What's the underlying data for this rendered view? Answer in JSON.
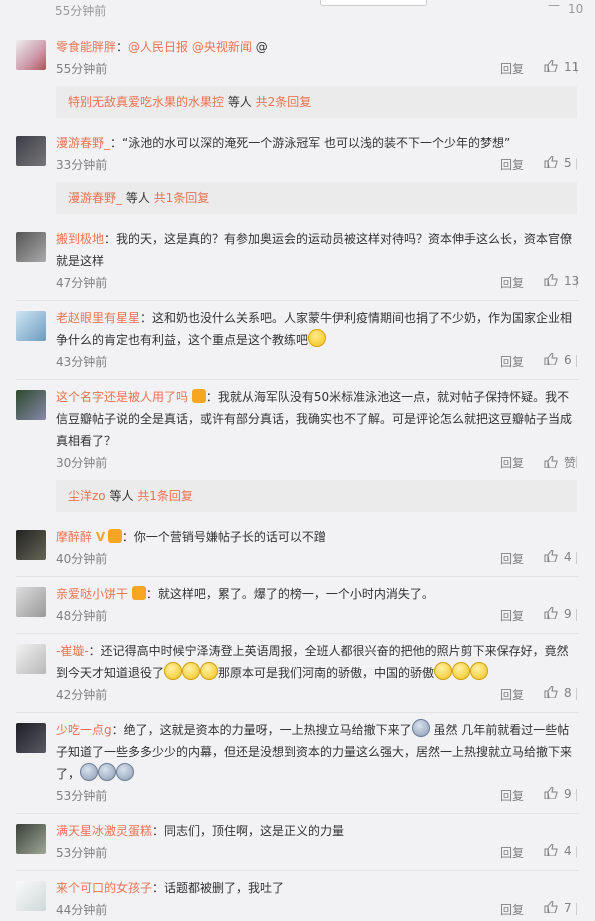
{
  "top_edge": {
    "left_text": "55分钟前",
    "right_count": "10"
  },
  "reply_label": "回复",
  "comments": [
    {
      "user": "零食能胖胖",
      "text_parts": [
        "：",
        "@人民日报",
        " ",
        "@央视新闻",
        " @"
      ],
      "time": "55分钟前",
      "likes": "11",
      "sub": {
        "names": "特别无敌真爱吃水果的水果控",
        "mid": " 等人 ",
        "count": "共2条回复"
      }
    },
    {
      "user": "漫游春野_",
      "text": "：“泳池的水可以深的淹死一个游泳冠军 也可以浅的装不下一个少年的梦想”",
      "time": "33分钟前",
      "likes": "5",
      "sub": {
        "names": "漫游春野_",
        "mid": " 等人 ",
        "count": "共1条回复"
      }
    },
    {
      "user": "搬到极地",
      "text": "：我的天，这是真的？有参加奥运会的运动员被这样对待吗？资本伸手这么长，资本官僚就是这样",
      "time": "47分钟前",
      "likes": "13"
    },
    {
      "user": "老赵眼里有星星",
      "text": "：这和奶也没什么关系吧。人家蒙牛伊利疫情期间也捐了不少奶，作为国家企业相争什么的肯定也有利益，这个重点是这个教练吧",
      "time": "43分钟前",
      "likes": "6"
    },
    {
      "user": "这个名字还是被人用了吗",
      "text": "：我就从海军队没有50米标准泳池这一点，就对帖子保持怀疑。我不信豆瓣帖子说的全是真话，或许有部分真话，我确实也不了解。可是评论怎么就把这豆瓣帖子当成真相看了？",
      "time": "30分钟前",
      "likes": "赞",
      "sub": {
        "names": "尘洋zo",
        "mid": " 等人 ",
        "count": "共1条回复"
      }
    },
    {
      "user": "摩醉醉",
      "text": "：你一个营销号嫌帖子长的话可以不蹭",
      "time": "40分钟前",
      "likes": "4"
    },
    {
      "user": "亲爱哒小饼干",
      "text": "：就这样吧，累了。爆了的榜一，一个小时内消失了。",
      "time": "48分钟前",
      "likes": "9"
    },
    {
      "user": "-崔璇-",
      "text": "：还记得高中时候宁泽涛登上英语周报，全班人都很兴奋的把他的照片剪下来保存好，竟然到今天才知道退役了",
      "text2": "那原本可是我们河南的骄傲，中国的骄傲",
      "time": "42分钟前",
      "likes": "8"
    },
    {
      "user": "少吃一点g",
      "text": "：绝了，这就是资本的力量呀，一上热搜立马给撤下来了",
      "text2": " 虽然 几年前就看过一些帖子知道了一些多多少少的内幕，但还是没想到资本的力量这么强大，居然一上热搜就立马给撤下来了，",
      "time": "53分钟前",
      "likes": "9"
    },
    {
      "user": "满天星冰激灵蛋糕",
      "text": "：同志们，顶住啊，这是正义的力量",
      "time": "53分钟前",
      "likes": "4"
    },
    {
      "user": "来个可口的女孩子",
      "text": "：话题都被删了，我吐了",
      "time": "44分钟前",
      "likes": "7"
    }
  ],
  "colors": {
    "accent": "#eb7350",
    "text": "#333333",
    "meta": "#808080",
    "subreply_bg": "#ebebeb"
  }
}
